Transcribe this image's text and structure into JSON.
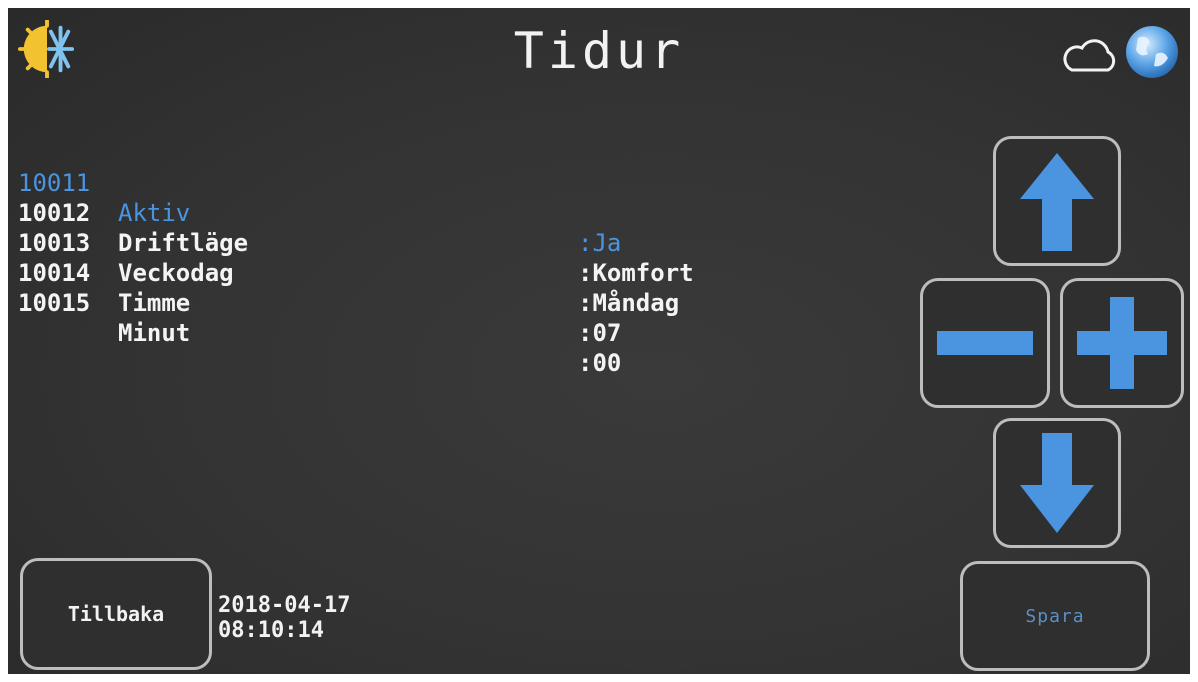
{
  "header": {
    "title": "Tidur",
    "mode_icon": "sun-snowflake-icon",
    "cloud_icon": "cloud-icon",
    "globe_icon": "globe-icon"
  },
  "params": [
    {
      "id": "10011",
      "name": "Aktiv",
      "value": ":Ja",
      "active": true
    },
    {
      "id": "10012",
      "name": "Driftläge",
      "value": ":Komfort",
      "active": false
    },
    {
      "id": "10013",
      "name": "Veckodag",
      "value": ":Måndag",
      "active": false
    },
    {
      "id": "10014",
      "name": "Timme",
      "value": ":07",
      "active": false
    },
    {
      "id": "10015",
      "name": "Minut",
      "value": ":00",
      "active": false
    }
  ],
  "controls": {
    "up_icon": "arrow-up-icon",
    "down_icon": "arrow-down-icon",
    "minus_icon": "minus-icon",
    "plus_icon": "plus-icon",
    "accent_color": "#4a94e0"
  },
  "footer": {
    "back_label": "Tillbaka",
    "save_label": "Spara",
    "date": "2018-04-17",
    "time": "08:10:14"
  }
}
